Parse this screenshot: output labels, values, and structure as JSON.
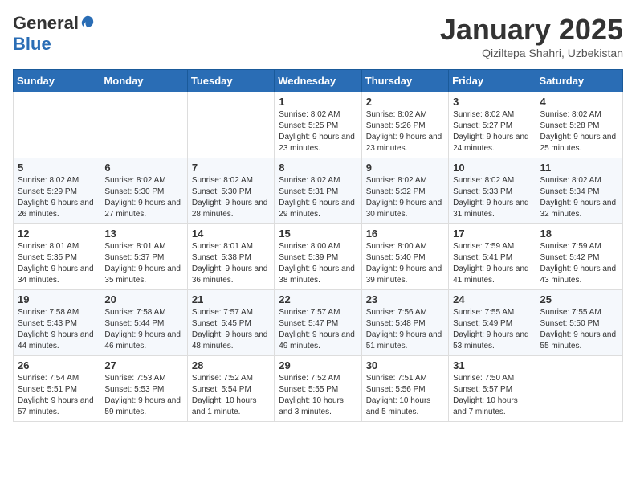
{
  "header": {
    "logo_general": "General",
    "logo_blue": "Blue",
    "month_title": "January 2025",
    "subtitle": "Qiziltepa Shahri, Uzbekistan"
  },
  "days_of_week": [
    "Sunday",
    "Monday",
    "Tuesday",
    "Wednesday",
    "Thursday",
    "Friday",
    "Saturday"
  ],
  "weeks": [
    [
      {
        "day": "",
        "info": ""
      },
      {
        "day": "",
        "info": ""
      },
      {
        "day": "",
        "info": ""
      },
      {
        "day": "1",
        "info": "Sunrise: 8:02 AM\nSunset: 5:25 PM\nDaylight: 9 hours\nand 23 minutes."
      },
      {
        "day": "2",
        "info": "Sunrise: 8:02 AM\nSunset: 5:26 PM\nDaylight: 9 hours\nand 23 minutes."
      },
      {
        "day": "3",
        "info": "Sunrise: 8:02 AM\nSunset: 5:27 PM\nDaylight: 9 hours\nand 24 minutes."
      },
      {
        "day": "4",
        "info": "Sunrise: 8:02 AM\nSunset: 5:28 PM\nDaylight: 9 hours\nand 25 minutes."
      }
    ],
    [
      {
        "day": "5",
        "info": "Sunrise: 8:02 AM\nSunset: 5:29 PM\nDaylight: 9 hours\nand 26 minutes."
      },
      {
        "day": "6",
        "info": "Sunrise: 8:02 AM\nSunset: 5:30 PM\nDaylight: 9 hours\nand 27 minutes."
      },
      {
        "day": "7",
        "info": "Sunrise: 8:02 AM\nSunset: 5:30 PM\nDaylight: 9 hours\nand 28 minutes."
      },
      {
        "day": "8",
        "info": "Sunrise: 8:02 AM\nSunset: 5:31 PM\nDaylight: 9 hours\nand 29 minutes."
      },
      {
        "day": "9",
        "info": "Sunrise: 8:02 AM\nSunset: 5:32 PM\nDaylight: 9 hours\nand 30 minutes."
      },
      {
        "day": "10",
        "info": "Sunrise: 8:02 AM\nSunset: 5:33 PM\nDaylight: 9 hours\nand 31 minutes."
      },
      {
        "day": "11",
        "info": "Sunrise: 8:02 AM\nSunset: 5:34 PM\nDaylight: 9 hours\nand 32 minutes."
      }
    ],
    [
      {
        "day": "12",
        "info": "Sunrise: 8:01 AM\nSunset: 5:35 PM\nDaylight: 9 hours\nand 34 minutes."
      },
      {
        "day": "13",
        "info": "Sunrise: 8:01 AM\nSunset: 5:37 PM\nDaylight: 9 hours\nand 35 minutes."
      },
      {
        "day": "14",
        "info": "Sunrise: 8:01 AM\nSunset: 5:38 PM\nDaylight: 9 hours\nand 36 minutes."
      },
      {
        "day": "15",
        "info": "Sunrise: 8:00 AM\nSunset: 5:39 PM\nDaylight: 9 hours\nand 38 minutes."
      },
      {
        "day": "16",
        "info": "Sunrise: 8:00 AM\nSunset: 5:40 PM\nDaylight: 9 hours\nand 39 minutes."
      },
      {
        "day": "17",
        "info": "Sunrise: 7:59 AM\nSunset: 5:41 PM\nDaylight: 9 hours\nand 41 minutes."
      },
      {
        "day": "18",
        "info": "Sunrise: 7:59 AM\nSunset: 5:42 PM\nDaylight: 9 hours\nand 43 minutes."
      }
    ],
    [
      {
        "day": "19",
        "info": "Sunrise: 7:58 AM\nSunset: 5:43 PM\nDaylight: 9 hours\nand 44 minutes."
      },
      {
        "day": "20",
        "info": "Sunrise: 7:58 AM\nSunset: 5:44 PM\nDaylight: 9 hours\nand 46 minutes."
      },
      {
        "day": "21",
        "info": "Sunrise: 7:57 AM\nSunset: 5:45 PM\nDaylight: 9 hours\nand 48 minutes."
      },
      {
        "day": "22",
        "info": "Sunrise: 7:57 AM\nSunset: 5:47 PM\nDaylight: 9 hours\nand 49 minutes."
      },
      {
        "day": "23",
        "info": "Sunrise: 7:56 AM\nSunset: 5:48 PM\nDaylight: 9 hours\nand 51 minutes."
      },
      {
        "day": "24",
        "info": "Sunrise: 7:55 AM\nSunset: 5:49 PM\nDaylight: 9 hours\nand 53 minutes."
      },
      {
        "day": "25",
        "info": "Sunrise: 7:55 AM\nSunset: 5:50 PM\nDaylight: 9 hours\nand 55 minutes."
      }
    ],
    [
      {
        "day": "26",
        "info": "Sunrise: 7:54 AM\nSunset: 5:51 PM\nDaylight: 9 hours\nand 57 minutes."
      },
      {
        "day": "27",
        "info": "Sunrise: 7:53 AM\nSunset: 5:53 PM\nDaylight: 9 hours\nand 59 minutes."
      },
      {
        "day": "28",
        "info": "Sunrise: 7:52 AM\nSunset: 5:54 PM\nDaylight: 10 hours\nand 1 minute."
      },
      {
        "day": "29",
        "info": "Sunrise: 7:52 AM\nSunset: 5:55 PM\nDaylight: 10 hours\nand 3 minutes."
      },
      {
        "day": "30",
        "info": "Sunrise: 7:51 AM\nSunset: 5:56 PM\nDaylight: 10 hours\nand 5 minutes."
      },
      {
        "day": "31",
        "info": "Sunrise: 7:50 AM\nSunset: 5:57 PM\nDaylight: 10 hours\nand 7 minutes."
      },
      {
        "day": "",
        "info": ""
      }
    ]
  ]
}
